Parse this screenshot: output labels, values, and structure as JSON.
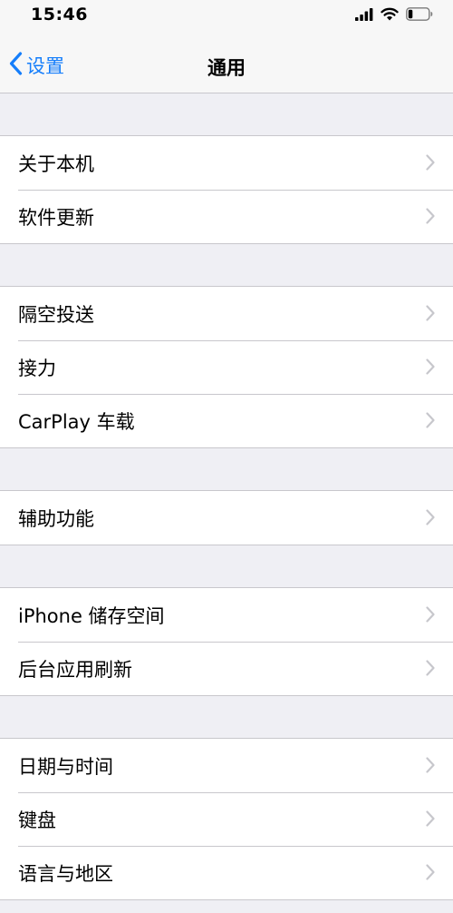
{
  "status_bar": {
    "time": "15:46",
    "icons": [
      "signal-icon",
      "wifi-icon",
      "battery-icon"
    ]
  },
  "nav": {
    "back_label": "设置",
    "title": "通用"
  },
  "colors": {
    "accent": "#157efb",
    "background": "#efeff4",
    "separator": "#c8c7cc",
    "chevron": "#c7c7cc"
  },
  "groups": [
    {
      "items": [
        {
          "label": "关于本机"
        },
        {
          "label": "软件更新"
        }
      ]
    },
    {
      "items": [
        {
          "label": "隔空投送"
        },
        {
          "label": "接力"
        },
        {
          "label": "CarPlay 车载"
        }
      ]
    },
    {
      "items": [
        {
          "label": "辅助功能"
        }
      ]
    },
    {
      "items": [
        {
          "label": "iPhone 储存空间"
        },
        {
          "label": "后台应用刷新"
        }
      ]
    },
    {
      "items": [
        {
          "label": "日期与时间"
        },
        {
          "label": "键盘"
        },
        {
          "label": "语言与地区"
        }
      ]
    }
  ]
}
